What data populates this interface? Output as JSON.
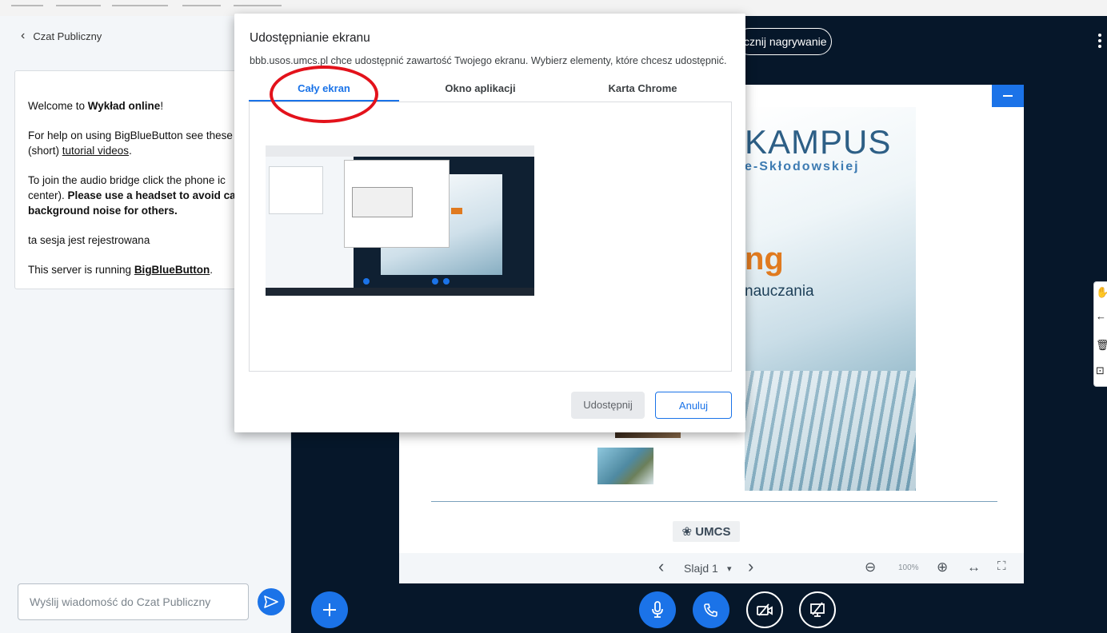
{
  "chat": {
    "header": "Czat Publiczny",
    "welcome": {
      "l1_a": "Welcome to ",
      "l1_b": "Wykład online",
      "l1_c": "!",
      "l2_a": "For help on using BigBlueButton see these",
      "l2_b": "(short) ",
      "l2_c": "tutorial videos",
      "l2_d": ".",
      "l3_a": "To join the audio bridge click the phone ic",
      "l3_b": "center). ",
      "l3_c": "Please use a headset to avoid ca",
      "l3_d": "background noise for others.",
      "l4": "ta sesja jest rejestrowana",
      "l5_a": "This server is running ",
      "l5_b": "BigBlueButton",
      "l5_c": "."
    },
    "input_placeholder": "Wyślij wiadomość do Czat Publiczny"
  },
  "main": {
    "record_label": "cznij nagrywanie"
  },
  "slide": {
    "kampus": "KAMPUS",
    "sklodowskiej": "e-Skłodowskiej",
    "ng": "ng",
    "nauczania": "nauczania",
    "logo": "UMCS"
  },
  "slide_controls": {
    "prev": "‹",
    "label": "Slajd 1",
    "dropdown": "▾",
    "next": "›",
    "zoom_out": "⊖",
    "zoom_level": "100%",
    "zoom_in": "⊕",
    "fit_width": "↔",
    "fullscreen": "⛶"
  },
  "dialog": {
    "title": "Udostępnianie ekranu",
    "subtitle": "bbb.usos.umcs.pl chce udostępnić zawartość Twojego ekranu. Wybierz elementy, które chcesz udostępnić.",
    "tabs": [
      "Cały ekran",
      "Okno aplikacji",
      "Karta Chrome"
    ],
    "share_button": "Udostępnij",
    "cancel_button": "Anuluj"
  },
  "colors": {
    "accent": "#1a73e8",
    "main_bg": "#06172a",
    "annotation": "#e3121b"
  }
}
